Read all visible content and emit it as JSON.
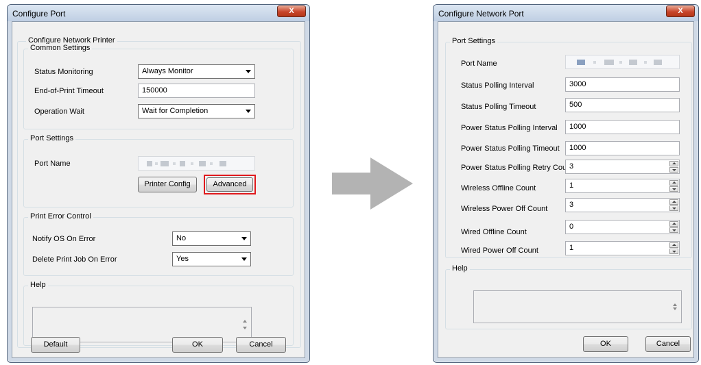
{
  "left_window": {
    "title": "Configure Port",
    "close_label": "X",
    "main_group": "Configure Network Printer",
    "common_settings": {
      "legend": "Common Settings",
      "status_monitoring_label": "Status Monitoring",
      "status_monitoring_value": "Always Monitor",
      "end_of_print_timeout_label": "End-of-Print Timeout",
      "end_of_print_timeout_value": "150000",
      "operation_wait_label": "Operation Wait",
      "operation_wait_value": "Wait for Completion"
    },
    "port_settings": {
      "legend": "Port Settings",
      "port_name_label": "Port Name",
      "printer_config_label": "Printer Config",
      "advanced_label": "Advanced"
    },
    "print_error_control": {
      "legend": "Print Error Control",
      "notify_label": "Notify OS On Error",
      "notify_value": "No",
      "delete_label": "Delete Print Job On Error",
      "delete_value": "Yes"
    },
    "help_legend": "Help",
    "default_label": "Default",
    "ok_label": "OK",
    "cancel_label": "Cancel"
  },
  "right_window": {
    "title": "Configure Network Port",
    "close_label": "X",
    "port_settings_legend": "Port Settings",
    "port_name_label": "Port Name",
    "fields": {
      "status_polling_interval": {
        "label": "Status Polling Interval",
        "value": "3000"
      },
      "status_polling_timeout": {
        "label": "Status Polling Timeout",
        "value": "500"
      },
      "power_status_polling_interval": {
        "label": "Power Status Polling Interval",
        "value": "1000"
      },
      "power_status_polling_timeout": {
        "label": "Power Status Polling Timeout",
        "value": "1000"
      },
      "power_status_polling_retry_count": {
        "label": "Power Status Polling Retry Count",
        "value": "3"
      },
      "wireless_offline_count": {
        "label": "Wireless Offline Count",
        "value": "1"
      },
      "wireless_power_off_count": {
        "label": "Wireless Power Off Count",
        "value": "3"
      },
      "wired_offline_count": {
        "label": "Wired Offline Count",
        "value": "0"
      },
      "wired_power_off_count": {
        "label": "Wired Power Off Count",
        "value": "1"
      }
    },
    "help_legend": "Help",
    "ok_label": "OK",
    "cancel_label": "Cancel"
  },
  "colors": {
    "highlight": "#e0191c",
    "arrow": "#b3b3b3",
    "close_button": "#c7452a"
  },
  "icons": {
    "close": "close-icon",
    "arrow": "right-arrow-icon",
    "dropdown": "chevron-down-icon"
  }
}
